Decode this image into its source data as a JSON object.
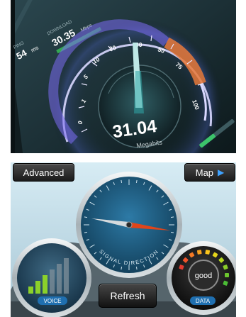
{
  "speedtest": {
    "ping_label": "PING",
    "ping_value": "54",
    "ping_unit": "ms",
    "download_label": "DOWNLOAD",
    "download_value": "30.35",
    "download_unit": "Mbps",
    "dial_ticks": [
      "0",
      "1",
      "5",
      "10",
      "20",
      "30",
      "50",
      "75",
      "100"
    ],
    "speed_value": "31.04",
    "speed_unit": "Megabits"
  },
  "signal_app": {
    "advanced_label": "Advanced",
    "map_label": "Map",
    "compass_caption": "SIGNAL DIRECTION",
    "voice_label": "VOICE",
    "data_label": "DATA",
    "data_quality": "good",
    "refresh_label": "Refresh",
    "voice_bars_lit": 3,
    "voice_bars_total": 6,
    "colors": {
      "bar_green": "#8bd12a",
      "dial_blue": "#1d5f86",
      "needle_red": "#e0451a"
    }
  }
}
